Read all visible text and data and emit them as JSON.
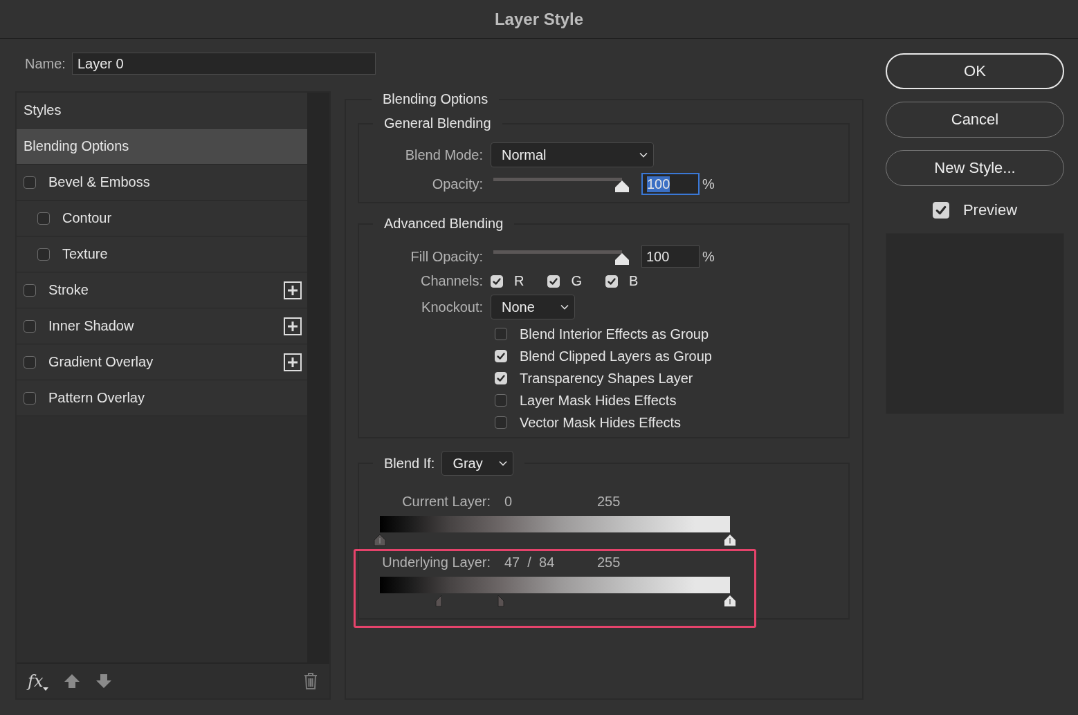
{
  "window": {
    "title": "Layer Style"
  },
  "name_field": {
    "label": "Name:",
    "value": "Layer 0"
  },
  "styles_list": {
    "items": [
      {
        "label": "Styles",
        "kind": "header",
        "selected": false
      },
      {
        "label": "Blending Options",
        "kind": "header",
        "selected": true
      },
      {
        "label": "Bevel & Emboss",
        "kind": "effect",
        "selected": false,
        "checked": false,
        "addable": false,
        "children": [
          {
            "label": "Contour",
            "kind": "effect",
            "selected": false,
            "checked": false,
            "addable": false
          },
          {
            "label": "Texture",
            "kind": "effect",
            "selected": false,
            "checked": false,
            "addable": false
          }
        ]
      },
      {
        "label": "Stroke",
        "kind": "effect",
        "selected": false,
        "checked": false,
        "addable": true
      },
      {
        "label": "Inner Shadow",
        "kind": "effect",
        "selected": false,
        "checked": false,
        "addable": true
      },
      {
        "label": "Gradient Overlay",
        "kind": "effect",
        "selected": false,
        "checked": false,
        "addable": true
      },
      {
        "label": "Pattern Overlay",
        "kind": "effect",
        "selected": false,
        "checked": false,
        "addable": false
      }
    ]
  },
  "footer": {
    "fx_label": "fx"
  },
  "blending_options": {
    "title": "Blending Options",
    "general": {
      "title": "General Blending",
      "blend_mode": {
        "label": "Blend Mode:",
        "value": "Normal"
      },
      "opacity": {
        "label": "Opacity:",
        "level": 1,
        "value": "100",
        "unit": "%",
        "focused": true
      }
    },
    "advanced": {
      "title": "Advanced Blending",
      "fill_opacity": {
        "label": "Fill Opacity:",
        "level": 1,
        "value": "100",
        "unit": "%",
        "focused": false
      },
      "channels": {
        "label": "Channels:",
        "items": [
          {
            "label": "R",
            "checked": true
          },
          {
            "label": "G",
            "checked": true
          },
          {
            "label": "B",
            "checked": true
          }
        ]
      },
      "knockout": {
        "label": "Knockout:",
        "value": "None"
      },
      "options": [
        {
          "label": "Blend Interior Effects as Group",
          "checked": false
        },
        {
          "label": "Blend Clipped Layers as Group",
          "checked": true
        },
        {
          "label": "Transparency Shapes Layer",
          "checked": true
        },
        {
          "label": "Layer Mask Hides Effects",
          "checked": false
        },
        {
          "label": "Vector Mask Hides Effects",
          "checked": false
        }
      ]
    },
    "blend_if": {
      "label": "Blend If:",
      "value": "Gray",
      "layers": [
        {
          "label": "Current Layer:",
          "low": "0",
          "high": "255",
          "highlighted": false,
          "thumbs": [
            {
              "kind": "dark",
              "level": 0
            },
            {
              "kind": "light",
              "level": 1
            }
          ]
        },
        {
          "label": "Underlying Layer:",
          "low": "47  /  84",
          "high": "255",
          "highlighted": true,
          "thumbs": [
            {
              "kind": "left",
              "level": 0.176
            },
            {
              "kind": "right",
              "level": 0.338
            },
            {
              "kind": "light",
              "level": 1
            }
          ]
        }
      ]
    }
  },
  "buttons": [
    {
      "label": "OK",
      "default": true
    },
    {
      "label": "Cancel",
      "default": false
    },
    {
      "label": "New Style...",
      "default": false
    }
  ],
  "preview": {
    "label": "Preview",
    "checked": true
  }
}
